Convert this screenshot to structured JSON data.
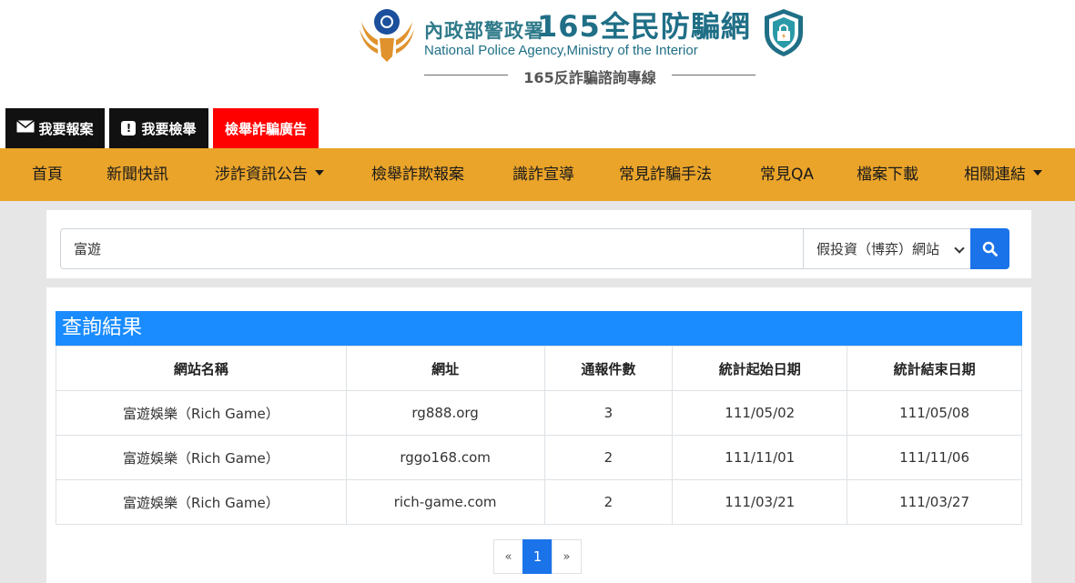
{
  "header": {
    "org_name_cn": "內政部警政署",
    "site_name_cn": "165全民防騙網",
    "org_name_en": "National Police Agency,Ministry of the Interior",
    "hotline": "165反詐騙諮詢專線",
    "emblem_icon": "police-emblem-icon",
    "shield_icon": "security-shield-icon"
  },
  "quick_buttons": [
    {
      "label": "我要報案",
      "icon": "envelope-icon"
    },
    {
      "label": "我要檢舉",
      "icon": "exclamation-icon"
    },
    {
      "label": "檢舉詐騙廣告"
    }
  ],
  "nav": {
    "items": [
      {
        "label": "首頁"
      },
      {
        "label": "新聞快訊"
      },
      {
        "label": "涉詐資訊公告",
        "dropdown": true
      },
      {
        "label": "檢舉詐欺報案"
      },
      {
        "label": "識詐宣導"
      },
      {
        "label": "常見詐騙手法"
      },
      {
        "label": "常見QA"
      },
      {
        "label": "檔案下載"
      },
      {
        "label": "相關連結",
        "dropdown": true
      }
    ]
  },
  "search": {
    "query": "富遊",
    "category": "假投資（博弈）網站",
    "button_icon": "search-icon"
  },
  "results": {
    "title": "查詢結果",
    "columns": [
      "網站名稱",
      "網址",
      "通報件數",
      "統計起始日期",
      "統計結束日期"
    ],
    "rows": [
      [
        "富遊娛樂（Rich Game）",
        "rg888.org",
        "3",
        "111/05/02",
        "111/05/08"
      ],
      [
        "富遊娛樂（Rich Game）",
        "rggo168.com",
        "2",
        "111/11/01",
        "111/11/06"
      ],
      [
        "富遊娛樂（Rich Game）",
        "rich-game.com",
        "2",
        "111/03/21",
        "111/03/27"
      ]
    ]
  },
  "pagination": {
    "prev": "«",
    "current": "1",
    "next": "»"
  },
  "colors": {
    "nav_bg": "#eaa42a",
    "accent_blue": "#1a73e8",
    "title_bar": "#1a8cff",
    "report_ad_red": "#ff0000",
    "brand_teal": "#1f6f86"
  }
}
